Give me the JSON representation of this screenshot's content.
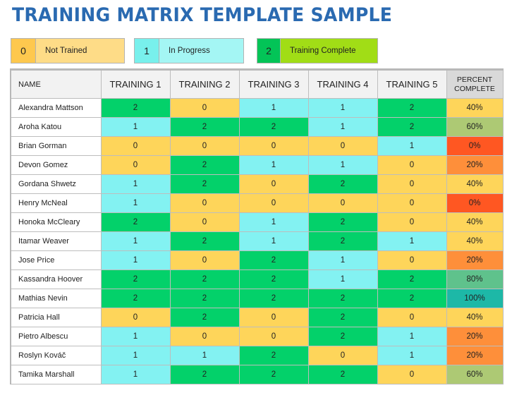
{
  "title": "TRAINING MATRIX TEMPLATE SAMPLE",
  "colors": {
    "title": "#2a6ab1",
    "level_0": "#fed55a",
    "level_1": "#83f2f2",
    "level_2": "#03d16a",
    "pct_0": "#ff5722",
    "pct_20": "#fe8f3a",
    "pct_40": "#fed55a",
    "pct_60": "#adc974",
    "pct_80": "#5fc28c",
    "pct_100": "#1db8a7"
  },
  "legend": [
    {
      "value": "0",
      "label": "Not Trained"
    },
    {
      "value": "1",
      "label": "In Progress"
    },
    {
      "value": "2",
      "label": "Training Complete"
    }
  ],
  "table": {
    "headers": {
      "name": "NAME",
      "trainings": [
        "TRAINING 1",
        "TRAINING 2",
        "TRAINING 3",
        "TRAINING 4",
        "TRAINING 5"
      ],
      "percent_line1": "PERCENT",
      "percent_line2": "COMPLETE"
    },
    "rows": [
      {
        "name": "Alexandra Mattson",
        "scores": [
          2,
          0,
          1,
          1,
          2
        ],
        "percent": "40%"
      },
      {
        "name": "Aroha Katou",
        "scores": [
          1,
          2,
          2,
          1,
          2
        ],
        "percent": "60%"
      },
      {
        "name": "Brian Gorman",
        "scores": [
          0,
          0,
          0,
          0,
          1
        ],
        "percent": "0%"
      },
      {
        "name": "Devon Gomez",
        "scores": [
          0,
          2,
          1,
          1,
          0
        ],
        "percent": "20%"
      },
      {
        "name": "Gordana Shwetz",
        "scores": [
          1,
          2,
          0,
          2,
          0
        ],
        "percent": "40%"
      },
      {
        "name": "Henry McNeal",
        "scores": [
          1,
          0,
          0,
          0,
          0
        ],
        "percent": "0%"
      },
      {
        "name": "Honoka McCleary",
        "scores": [
          2,
          0,
          1,
          2,
          0
        ],
        "percent": "40%"
      },
      {
        "name": "Itamar Weaver",
        "scores": [
          1,
          2,
          1,
          2,
          1
        ],
        "percent": "40%"
      },
      {
        "name": "Jose Price",
        "scores": [
          1,
          0,
          2,
          1,
          0
        ],
        "percent": "20%"
      },
      {
        "name": "Kassandra Hoover",
        "scores": [
          2,
          2,
          2,
          1,
          2
        ],
        "percent": "80%"
      },
      {
        "name": "Mathias Nevin",
        "scores": [
          2,
          2,
          2,
          2,
          2
        ],
        "percent": "100%"
      },
      {
        "name": "Patricia Hall",
        "scores": [
          0,
          2,
          0,
          2,
          0
        ],
        "percent": "40%"
      },
      {
        "name": "Pietro Albescu",
        "scores": [
          1,
          0,
          0,
          2,
          1
        ],
        "percent": "20%"
      },
      {
        "name": "Roslyn Kováč",
        "scores": [
          1,
          1,
          2,
          0,
          1
        ],
        "percent": "20%"
      },
      {
        "name": "Tamika Marshall",
        "scores": [
          1,
          2,
          2,
          2,
          0
        ],
        "percent": "60%"
      }
    ]
  }
}
